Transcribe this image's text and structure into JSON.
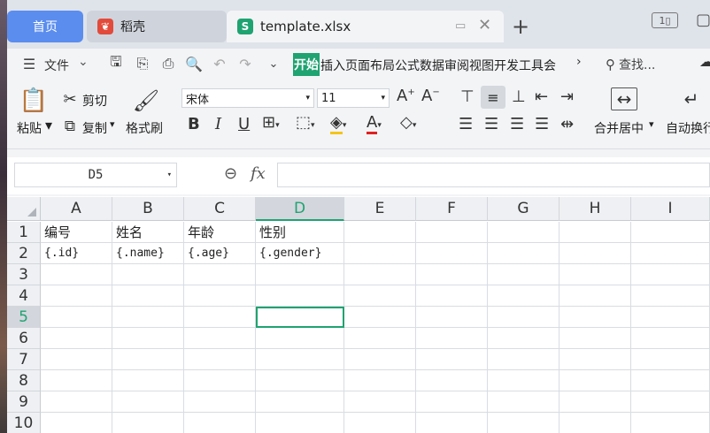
{
  "tabs": {
    "home": "首页",
    "daoke": "稻壳",
    "file": "template.xlsx",
    "daoke_color": "#e24a3b",
    "file_color": "#1fa371"
  },
  "menu": {
    "file_label": "文件",
    "start_label": "开始",
    "tabs_text": "插入页面布局公式数据审阅视图开发工具会",
    "search_label": "查找..."
  },
  "ribbon": {
    "paste": "粘贴",
    "cut": "剪切",
    "copy": "复制",
    "format_painter": "格式刷",
    "font_name": "宋体",
    "font_size": "11",
    "merge_center": "合并居中",
    "auto_wrap": "自动换行"
  },
  "formula": {
    "cell_ref": "D5",
    "fx": "fx",
    "value": ""
  },
  "grid": {
    "columns": [
      "A",
      "B",
      "C",
      "D",
      "E",
      "F",
      "G",
      "H",
      "I"
    ],
    "rows": [
      "1",
      "2",
      "3",
      "4",
      "5",
      "6",
      "7",
      "8",
      "9",
      "10"
    ],
    "row1": [
      "编号",
      "姓名",
      "年龄",
      "性别"
    ],
    "row2": [
      "{.id}",
      "{.name}",
      "{.age}",
      "{.gender}"
    ],
    "selected_cell": "D5"
  },
  "colors": {
    "accent": "#1fa371",
    "home_tab": "#5b8def"
  }
}
